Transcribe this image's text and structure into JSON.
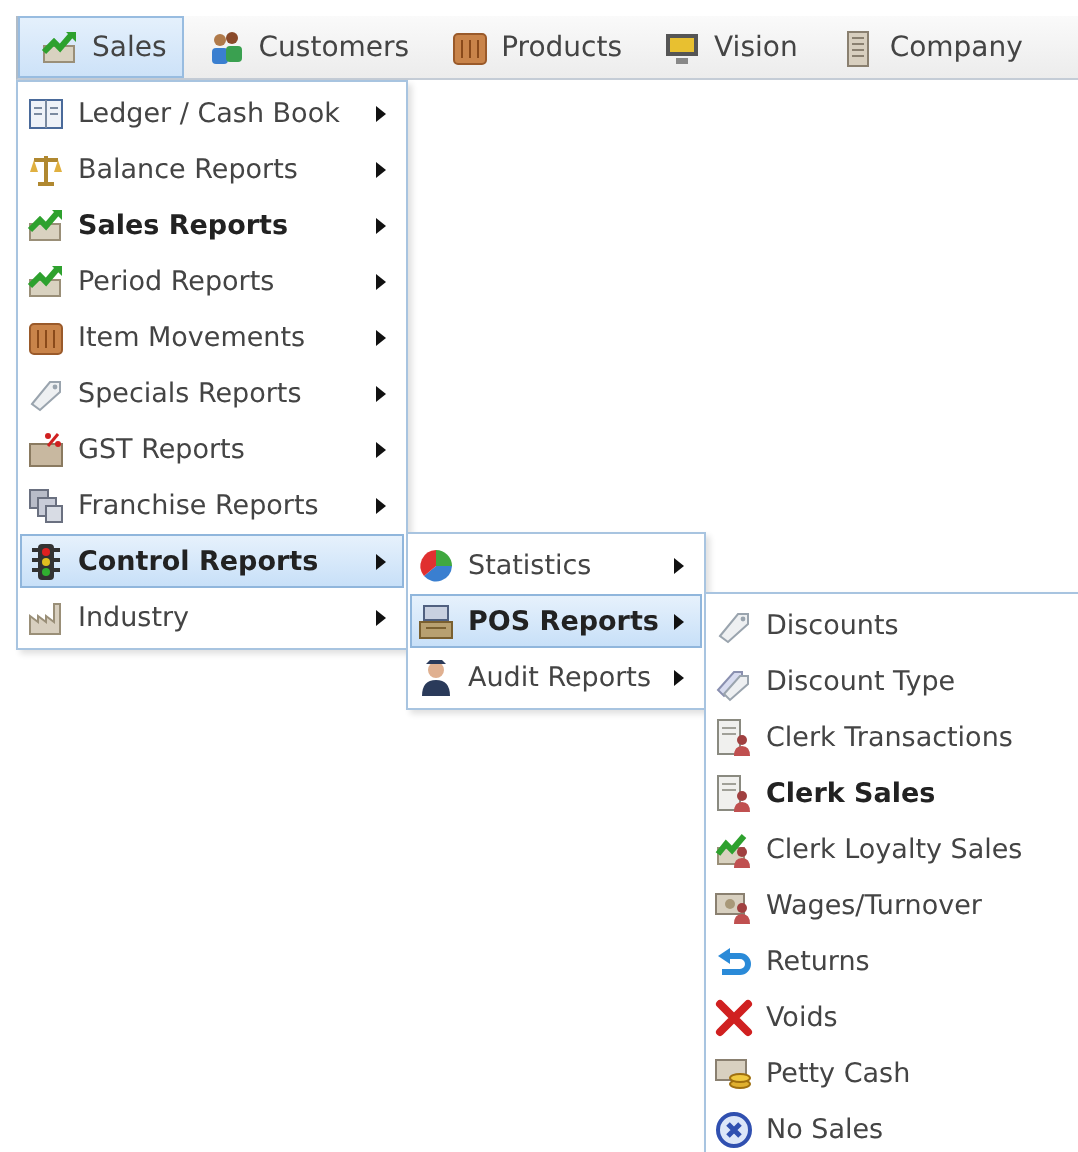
{
  "menu_bar": [
    {
      "label": "Sales",
      "selected": true
    },
    {
      "label": "Customers",
      "selected": false
    },
    {
      "label": "Products",
      "selected": false
    },
    {
      "label": "Vision",
      "selected": false
    },
    {
      "label": "Company",
      "selected": false
    }
  ],
  "sales_menu": [
    {
      "label": "Ledger / Cash Book",
      "bold": false,
      "selected": false,
      "submenu": true
    },
    {
      "label": "Balance Reports",
      "bold": false,
      "selected": false,
      "submenu": true
    },
    {
      "label": "Sales Reports",
      "bold": true,
      "selected": false,
      "submenu": true
    },
    {
      "label": "Period Reports",
      "bold": false,
      "selected": false,
      "submenu": true
    },
    {
      "label": "Item Movements",
      "bold": false,
      "selected": false,
      "submenu": true
    },
    {
      "label": "Specials Reports",
      "bold": false,
      "selected": false,
      "submenu": true
    },
    {
      "label": "GST Reports",
      "bold": false,
      "selected": false,
      "submenu": true
    },
    {
      "label": "Franchise Reports",
      "bold": false,
      "selected": false,
      "submenu": true
    },
    {
      "label": "Control Reports",
      "bold": true,
      "selected": true,
      "submenu": true
    },
    {
      "label": "Industry",
      "bold": false,
      "selected": false,
      "submenu": true
    }
  ],
  "control_reports_menu": [
    {
      "label": "Statistics",
      "bold": false,
      "selected": false,
      "submenu": true
    },
    {
      "label": "POS Reports",
      "bold": true,
      "selected": true,
      "submenu": true
    },
    {
      "label": "Audit Reports",
      "bold": false,
      "selected": false,
      "submenu": true
    }
  ],
  "pos_reports_menu": [
    {
      "label": "Discounts",
      "bold": false,
      "selected": false,
      "submenu": false
    },
    {
      "label": "Discount Type",
      "bold": false,
      "selected": false,
      "submenu": false
    },
    {
      "label": "Clerk Transactions",
      "bold": false,
      "selected": false,
      "submenu": false
    },
    {
      "label": "Clerk Sales",
      "bold": true,
      "selected": false,
      "submenu": false
    },
    {
      "label": "Clerk Loyalty Sales",
      "bold": false,
      "selected": false,
      "submenu": false
    },
    {
      "label": "Wages/Turnover",
      "bold": false,
      "selected": false,
      "submenu": false
    },
    {
      "label": "Returns",
      "bold": false,
      "selected": false,
      "submenu": false
    },
    {
      "label": "Voids",
      "bold": false,
      "selected": false,
      "submenu": false
    },
    {
      "label": "Petty Cash",
      "bold": false,
      "selected": false,
      "submenu": false
    },
    {
      "label": "No Sales",
      "bold": false,
      "selected": false,
      "submenu": false
    }
  ]
}
